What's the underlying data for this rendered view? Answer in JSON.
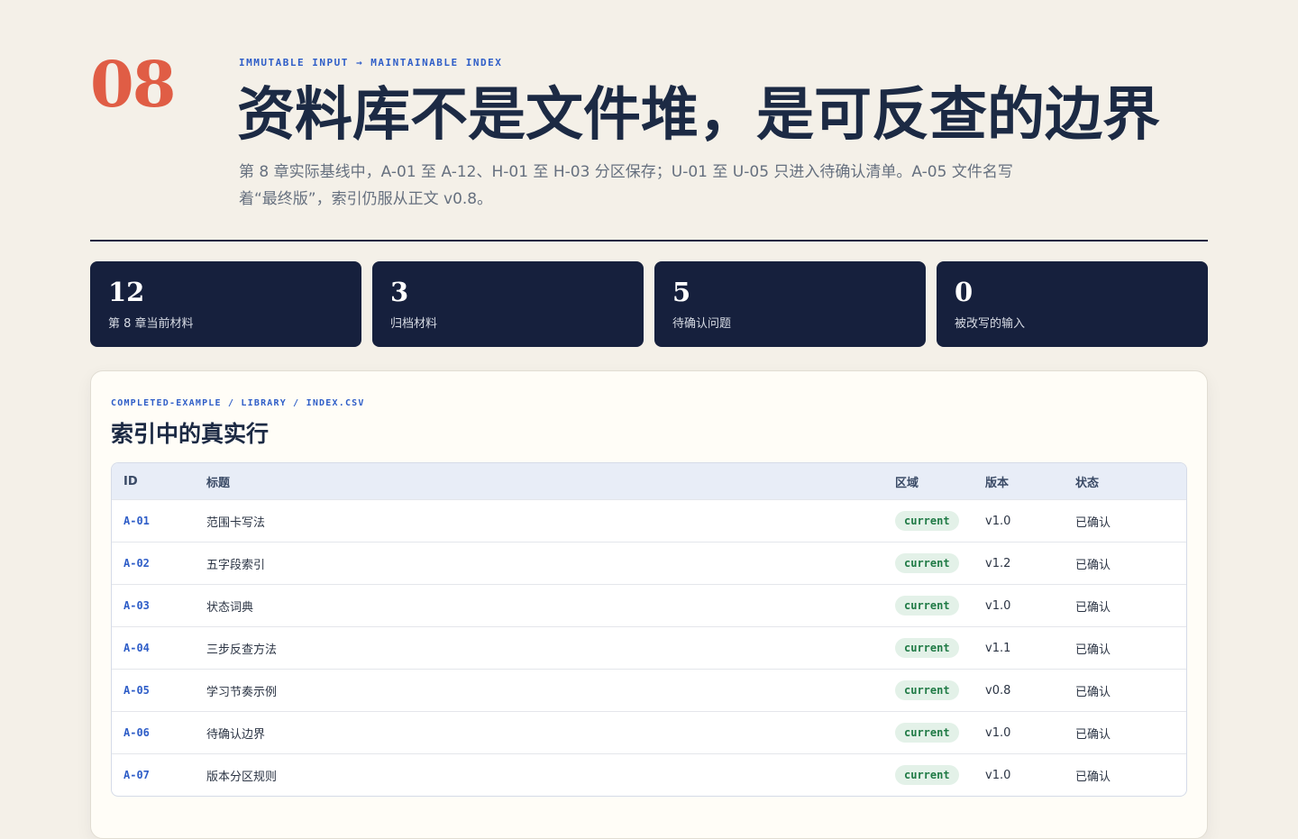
{
  "header": {
    "chapter": "08",
    "eyebrow": "IMMUTABLE INPUT → MAINTAINABLE INDEX",
    "title": "资料库不是文件堆，是可反查的边界",
    "lead": "第 8 章实际基线中，A-01 至 A-12、H-01 至 H-03 分区保存；U-01 至 U-05 只进入待确认清单。A-05 文件名写着“最终版”，索引仍服从正文 v0.8。"
  },
  "stats": [
    {
      "value": "12",
      "label": "第 8 章当前材料"
    },
    {
      "value": "3",
      "label": "归档材料"
    },
    {
      "value": "5",
      "label": "待确认问题"
    },
    {
      "value": "0",
      "label": "被改写的输入"
    }
  ],
  "panel": {
    "eyebrow": "COMPLETED-EXAMPLE / LIBRARY / INDEX.CSV",
    "title": "索引中的真实行"
  },
  "table": {
    "columns": {
      "id": "ID",
      "title": "标题",
      "zone": "区域",
      "version": "版本",
      "status": "状态"
    },
    "rows": [
      {
        "id": "A-01",
        "title": "范围卡写法",
        "zone": "current",
        "version": "v1.0",
        "status": "已确认"
      },
      {
        "id": "A-02",
        "title": "五字段索引",
        "zone": "current",
        "version": "v1.2",
        "status": "已确认"
      },
      {
        "id": "A-03",
        "title": "状态词典",
        "zone": "current",
        "version": "v1.0",
        "status": "已确认"
      },
      {
        "id": "A-04",
        "title": "三步反查方法",
        "zone": "current",
        "version": "v1.1",
        "status": "已确认"
      },
      {
        "id": "A-05",
        "title": "学习节奏示例",
        "zone": "current",
        "version": "v0.8",
        "status": "已确认"
      },
      {
        "id": "A-06",
        "title": "待确认边界",
        "zone": "current",
        "version": "v1.0",
        "status": "已确认"
      },
      {
        "id": "A-07",
        "title": "版本分区规则",
        "zone": "current",
        "version": "v1.0",
        "status": "已确认"
      }
    ]
  },
  "colors": {
    "accent": "#e05d45",
    "link": "#2f5ec8",
    "navy": "#16203d",
    "pill_bg": "#e3f1e8",
    "pill_text": "#1f7a45"
  }
}
